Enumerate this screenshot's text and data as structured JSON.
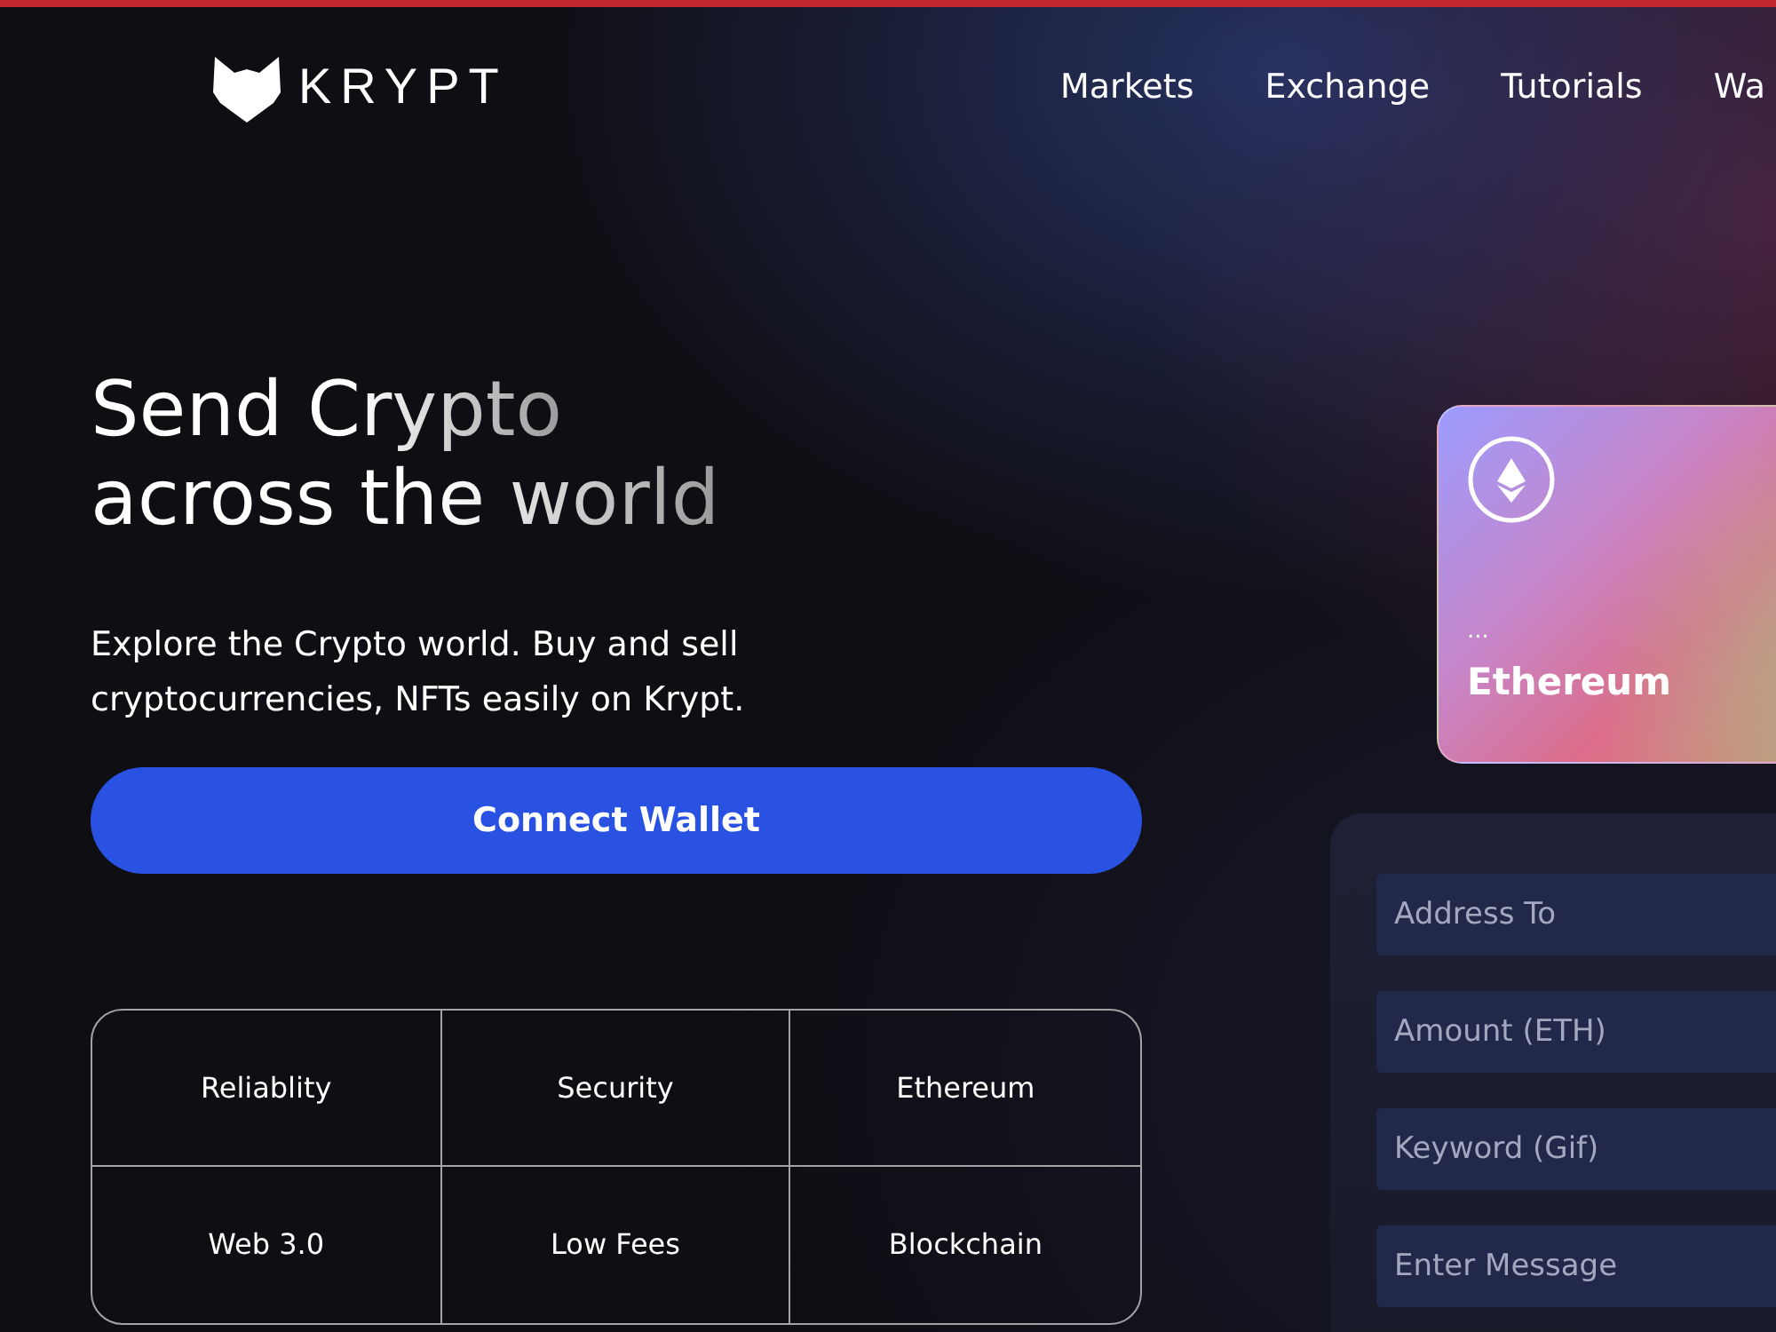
{
  "logo": {
    "text": "KRYPT"
  },
  "nav": [
    {
      "label": "Markets"
    },
    {
      "label": "Exchange"
    },
    {
      "label": "Tutorials"
    },
    {
      "label": "Wa"
    }
  ],
  "hero": {
    "title_lines": [
      "Send Crypto",
      "across the world"
    ],
    "description": "Explore the Crypto world. Buy and sell cryptocurrencies, NFTs easily on Krypt.",
    "button": "Connect Wallet"
  },
  "features": [
    "Reliablity",
    "Security",
    "Ethereum",
    "Web 3.0",
    "Low Fees",
    "Blockchain"
  ],
  "card": {
    "dots": "...",
    "name": "Ethereum"
  },
  "form": {
    "fields": [
      {
        "placeholder": "Address To"
      },
      {
        "placeholder": "Amount (ETH)"
      },
      {
        "placeholder": "Keyword (Gif)"
      },
      {
        "placeholder": "Enter Message"
      }
    ]
  }
}
